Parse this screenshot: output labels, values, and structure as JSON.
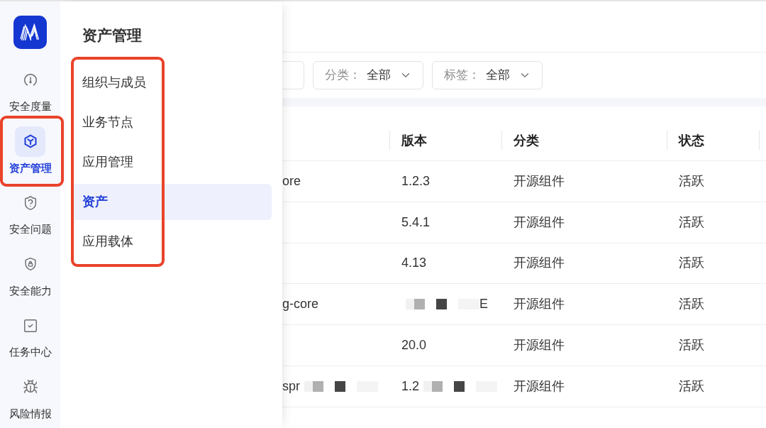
{
  "rail": {
    "items": [
      {
        "label": "安全度量",
        "selected": false,
        "highlighted": false
      },
      {
        "label": "资产管理",
        "selected": true,
        "highlighted": true
      },
      {
        "label": "安全问题",
        "selected": false,
        "highlighted": false
      },
      {
        "label": "安全能力",
        "selected": false,
        "highlighted": false
      },
      {
        "label": "任务中心",
        "selected": false,
        "highlighted": false
      },
      {
        "label": "风险情报",
        "selected": false,
        "highlighted": false
      }
    ]
  },
  "panel": {
    "title": "资产管理",
    "highlighted": true,
    "items": [
      {
        "label": "组织与成员",
        "selected": false
      },
      {
        "label": "业务节点",
        "selected": false
      },
      {
        "label": "应用管理",
        "selected": false
      },
      {
        "label": "资产",
        "selected": true
      },
      {
        "label": "应用载体",
        "selected": false
      }
    ]
  },
  "filters": [
    {
      "label": "分类：",
      "value": "全部"
    },
    {
      "label": "标签：",
      "value": "全部"
    }
  ],
  "table": {
    "columns": [
      "版本",
      "分类",
      "状态"
    ],
    "rows": [
      {
        "column_1": [
          {
            "kind": "text",
            "text": "ore"
          }
        ],
        "version": [
          {
            "kind": "text",
            "text": "1.2.3"
          }
        ],
        "category": "开源组件",
        "status": "活跃"
      },
      {
        "version": [
          {
            "kind": "text",
            "text": "5.4.1"
          }
        ],
        "category": "开源组件",
        "status": "活跃"
      },
      {
        "version": [
          {
            "kind": "text",
            "text": "4.13"
          }
        ],
        "category": "开源组件",
        "status": "活跃"
      },
      {
        "column_1": [
          {
            "kind": "text",
            "text": "g-core"
          }
        ],
        "version": [
          {
            "kind": "mask"
          },
          {
            "kind": "text",
            "text": "E"
          }
        ],
        "category": "开源组件",
        "status": "活跃"
      },
      {
        "version": [
          {
            "kind": "text",
            "text": "20.0"
          }
        ],
        "category": "开源组件",
        "status": "活跃"
      },
      {
        "column_1": [
          {
            "kind": "text",
            "text": "spr"
          },
          {
            "kind": "mask"
          }
        ],
        "version": [
          {
            "kind": "text",
            "text": "1.2"
          },
          {
            "kind": "mask"
          }
        ],
        "category": "开源组件",
        "status": "活跃"
      }
    ]
  }
}
